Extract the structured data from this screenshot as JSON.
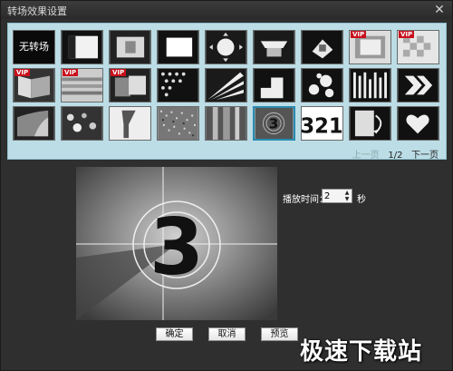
{
  "window": {
    "title": "转场效果设置"
  },
  "thumbnails": [
    {
      "label": "无转场",
      "vip": false,
      "selected": false
    },
    {
      "vip": false
    },
    {
      "vip": false
    },
    {
      "vip": false
    },
    {
      "vip": false
    },
    {
      "vip": false
    },
    {
      "vip": false
    },
    {
      "vip": true
    },
    {
      "vip": true
    },
    {
      "vip": true
    },
    {
      "vip": true
    },
    {
      "vip": true
    },
    {
      "vip": false
    },
    {
      "vip": false
    },
    {
      "vip": false
    },
    {
      "vip": false
    },
    {
      "vip": false
    },
    {
      "vip": false
    },
    {
      "vip": false
    },
    {
      "vip": false
    },
    {
      "vip": false
    },
    {
      "vip": false
    },
    {
      "vip": false
    },
    {
      "vip": false
    },
    {
      "vip": false
    },
    {
      "vip": false,
      "selected": true,
      "label": "3"
    },
    {
      "vip": false,
      "label": "321"
    },
    {
      "vip": false
    },
    {
      "vip": false
    }
  ],
  "vip_label": "VIP",
  "pagination": {
    "prev": "上一页",
    "current": "1",
    "separator": "/",
    "total": "2",
    "next": "下一页"
  },
  "preview": {
    "digit": "3"
  },
  "duration": {
    "label": "播放时间：",
    "value": "2",
    "unit": "秒"
  },
  "buttons": {
    "ok": "确定",
    "cancel": "取消",
    "preview": "预览"
  },
  "watermark": "极速下载站",
  "colors": {
    "panel": "#bcdde6",
    "selected_border": "#2a8ab0",
    "vip_badge": "#c8101c"
  }
}
